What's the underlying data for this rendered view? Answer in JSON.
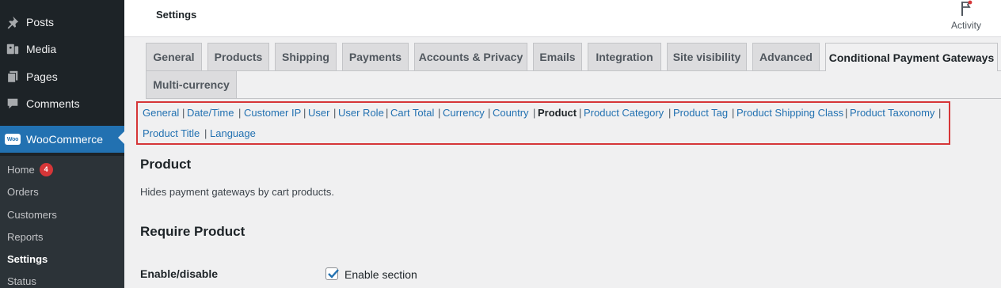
{
  "sidebar": {
    "menu": [
      {
        "label": "Posts",
        "icon": "pin-icon"
      },
      {
        "label": "Media",
        "icon": "media-icon"
      },
      {
        "label": "Pages",
        "icon": "pages-icon"
      },
      {
        "label": "Comments",
        "icon": "comments-icon"
      },
      {
        "label": "WooCommerce",
        "icon": "woocommerce-icon"
      }
    ],
    "woo_logo_text": "Woo",
    "submenu": [
      {
        "label": "Home",
        "badge": "4"
      },
      {
        "label": "Orders"
      },
      {
        "label": "Customers"
      },
      {
        "label": "Reports"
      },
      {
        "label": "Settings"
      },
      {
        "label": "Status"
      }
    ]
  },
  "header": {
    "title": "Settings",
    "activity_label": "Activity"
  },
  "tabs": {
    "row1": [
      "General",
      "Products",
      "Shipping",
      "Payments",
      "Accounts & Privacy",
      "Emails",
      "Integration",
      "Site visibility",
      "Advanced",
      "Conditional Payment Gateways"
    ],
    "row2": [
      "Multi-currency"
    ],
    "active": "Conditional Payment Gateways"
  },
  "sublinks": {
    "separator": "|",
    "items": [
      "General",
      "Date/Time",
      "Customer IP",
      "User",
      "User Role",
      "Cart Total",
      "Currency",
      "Country",
      "Product",
      "Product Category",
      "Product Tag",
      "Product Shipping Class",
      "Product Taxonomy",
      "Product Title",
      "Language"
    ],
    "current": "Product"
  },
  "content": {
    "section_title": "Product",
    "section_description": "Hides payment gateways by cart products.",
    "subsection_title": "Require Product",
    "enable_label": "Enable/disable",
    "enable_checkbox_label": "Enable section",
    "enable_checked": true
  },
  "colors": {
    "accent": "#2271b1",
    "sidebar_bg": "#1d2327",
    "highlight_border": "#d63638"
  }
}
